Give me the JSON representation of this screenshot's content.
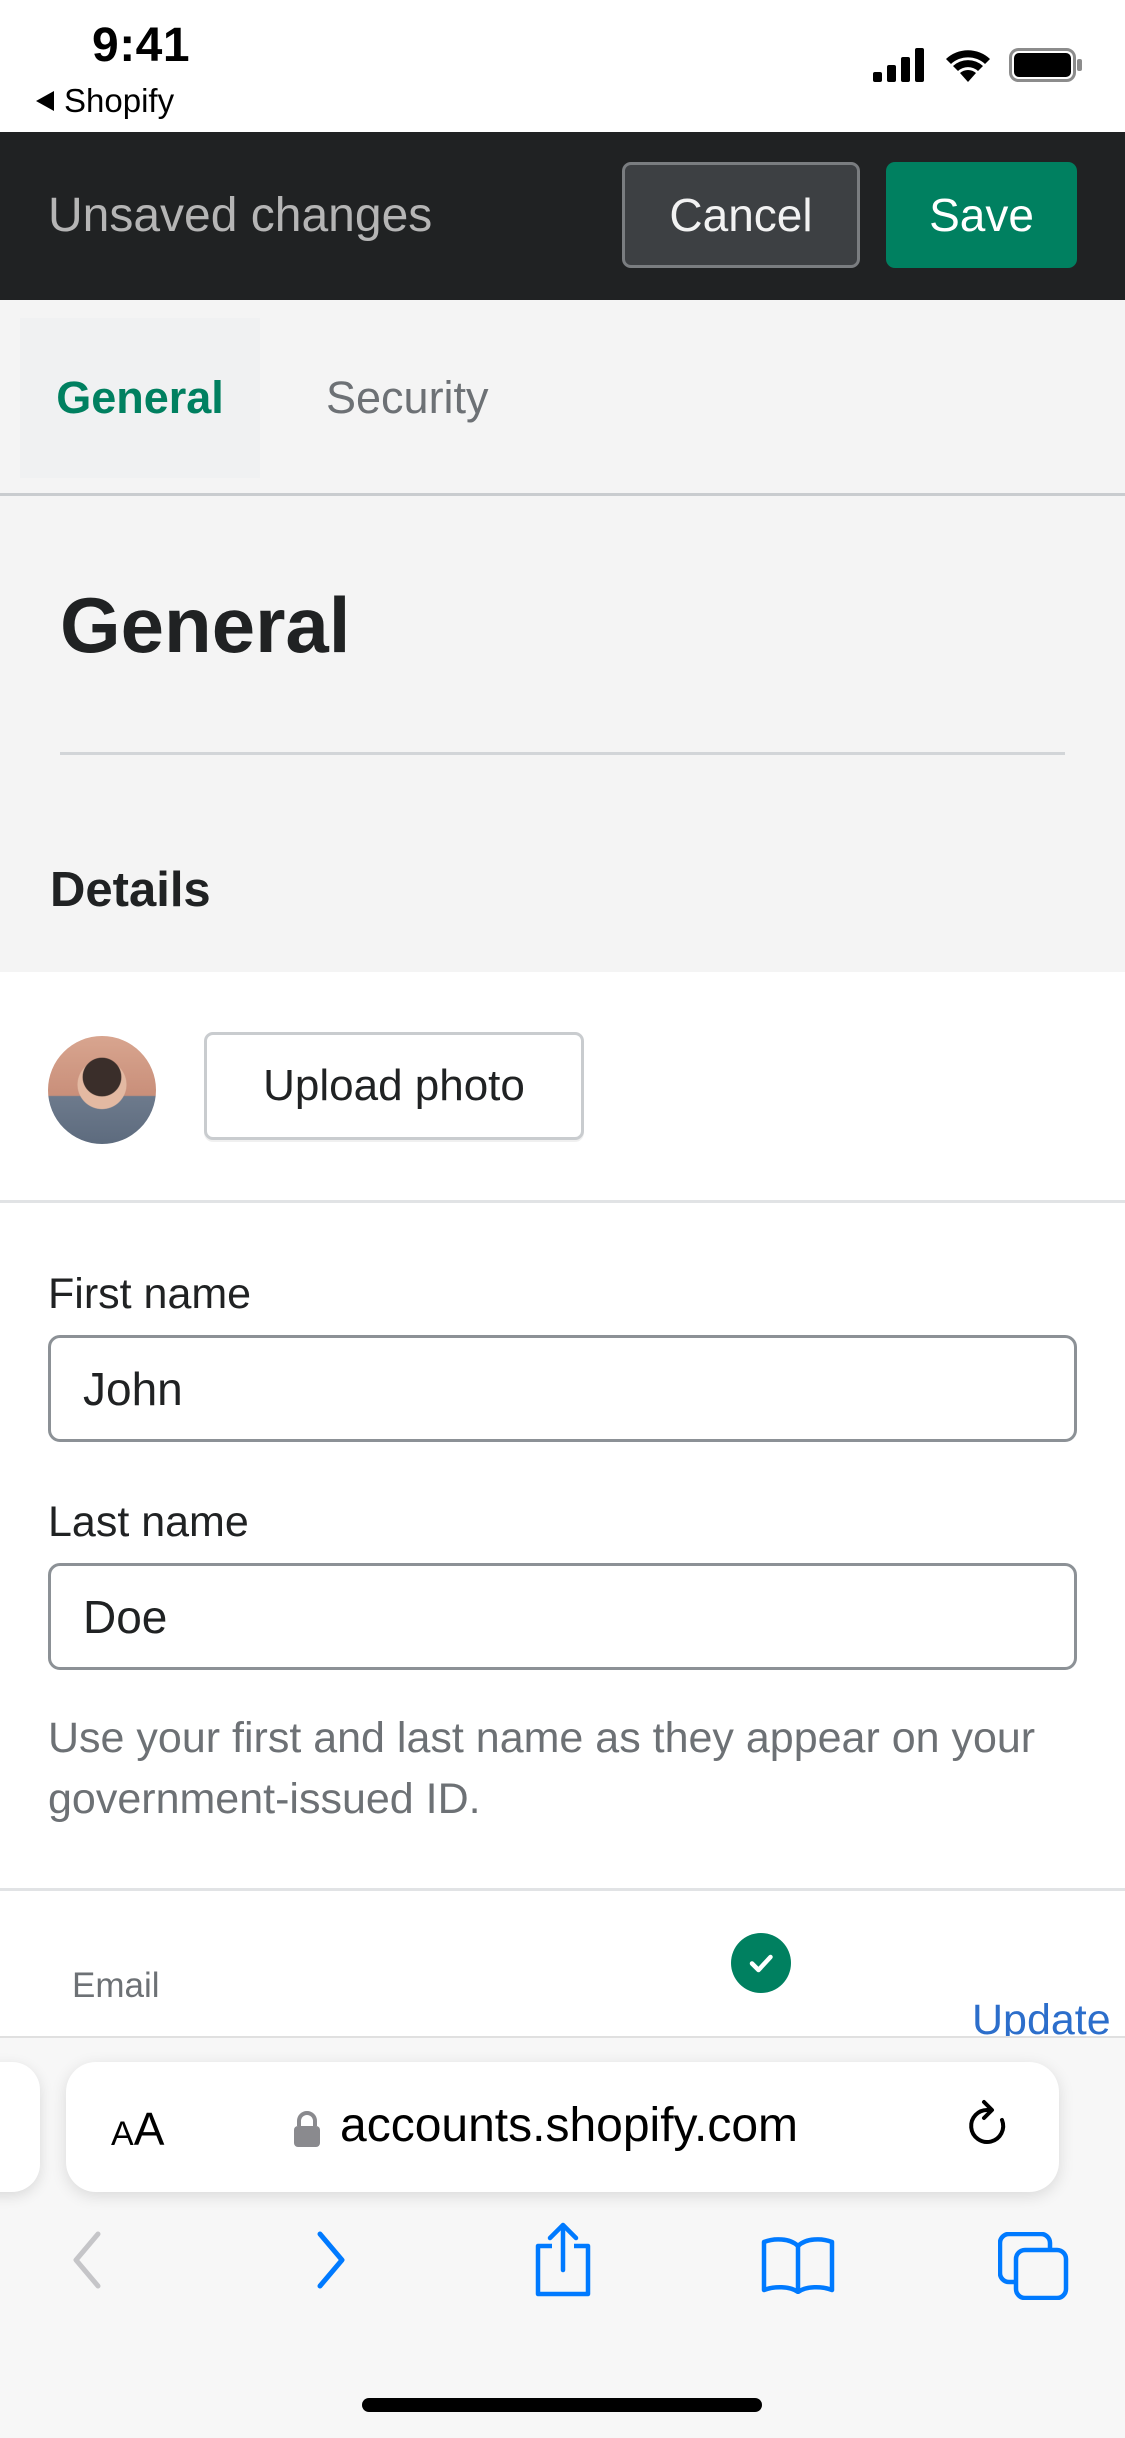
{
  "status_bar": {
    "time": "9:41",
    "back_app": "Shopify"
  },
  "unsaved_bar": {
    "title": "Unsaved changes",
    "cancel_label": "Cancel",
    "save_label": "Save"
  },
  "tabs": [
    {
      "label": "General",
      "selected": true
    },
    {
      "label": "Security",
      "selected": false
    }
  ],
  "page": {
    "title": "General",
    "section_title": "Details"
  },
  "details": {
    "upload_photo_label": "Upload photo",
    "first_name": {
      "label": "First name",
      "value": "John"
    },
    "last_name": {
      "label": "Last name",
      "value": "Doe"
    },
    "help_text": "Use your first and last name as they appear on your government-issued ID.",
    "email": {
      "label": "Email",
      "verified": true,
      "update_label": "Update"
    }
  },
  "safari": {
    "text_size_label_small": "A",
    "text_size_label_large": "A",
    "url": "accounts.shopify.com"
  },
  "colors": {
    "brand_green": "#008060",
    "bar_dark": "#202223",
    "link_blue": "#2c6ecb",
    "ios_blue": "#007aff"
  }
}
